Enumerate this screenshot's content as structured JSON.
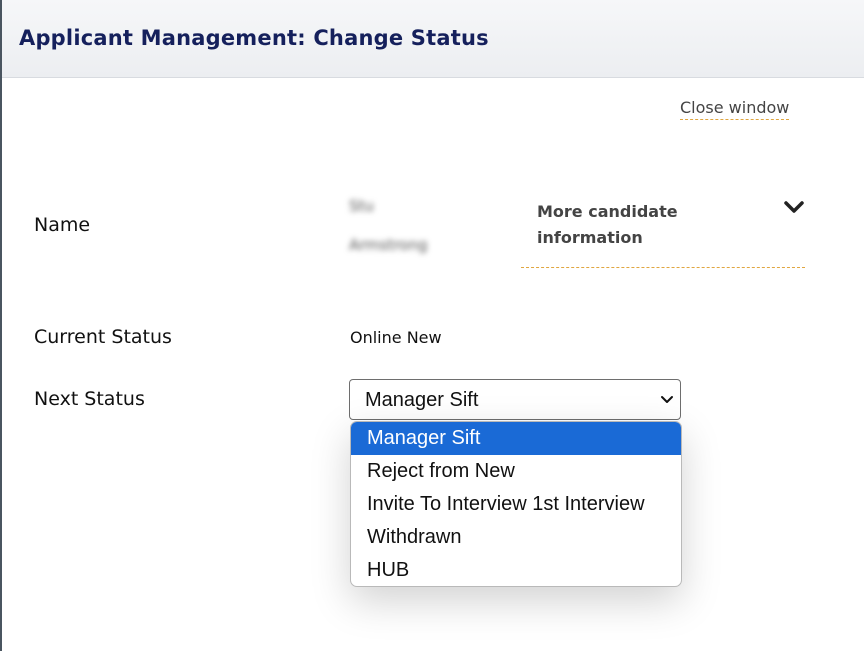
{
  "header": {
    "title": "Applicant Management: Change Status"
  },
  "close_window_label": "Close window",
  "form": {
    "name_label": "Name",
    "name_first": "Stu",
    "name_last": "Armstrong",
    "more_info_label": "More candidate information",
    "more_info_icon": "chevron-down-icon",
    "current_status_label": "Current Status",
    "current_status_value": "Online New",
    "next_status_label": "Next Status",
    "next_status_selected": "Manager Sift"
  },
  "dropdown": {
    "options": [
      "Manager Sift",
      "Reject from New",
      "Invite To Interview 1st Interview",
      "Withdrawn",
      "HUB"
    ],
    "highlighted_color": "#1a6ad6"
  },
  "colors": {
    "title": "#15205c",
    "link_underline": "#e0a640"
  }
}
